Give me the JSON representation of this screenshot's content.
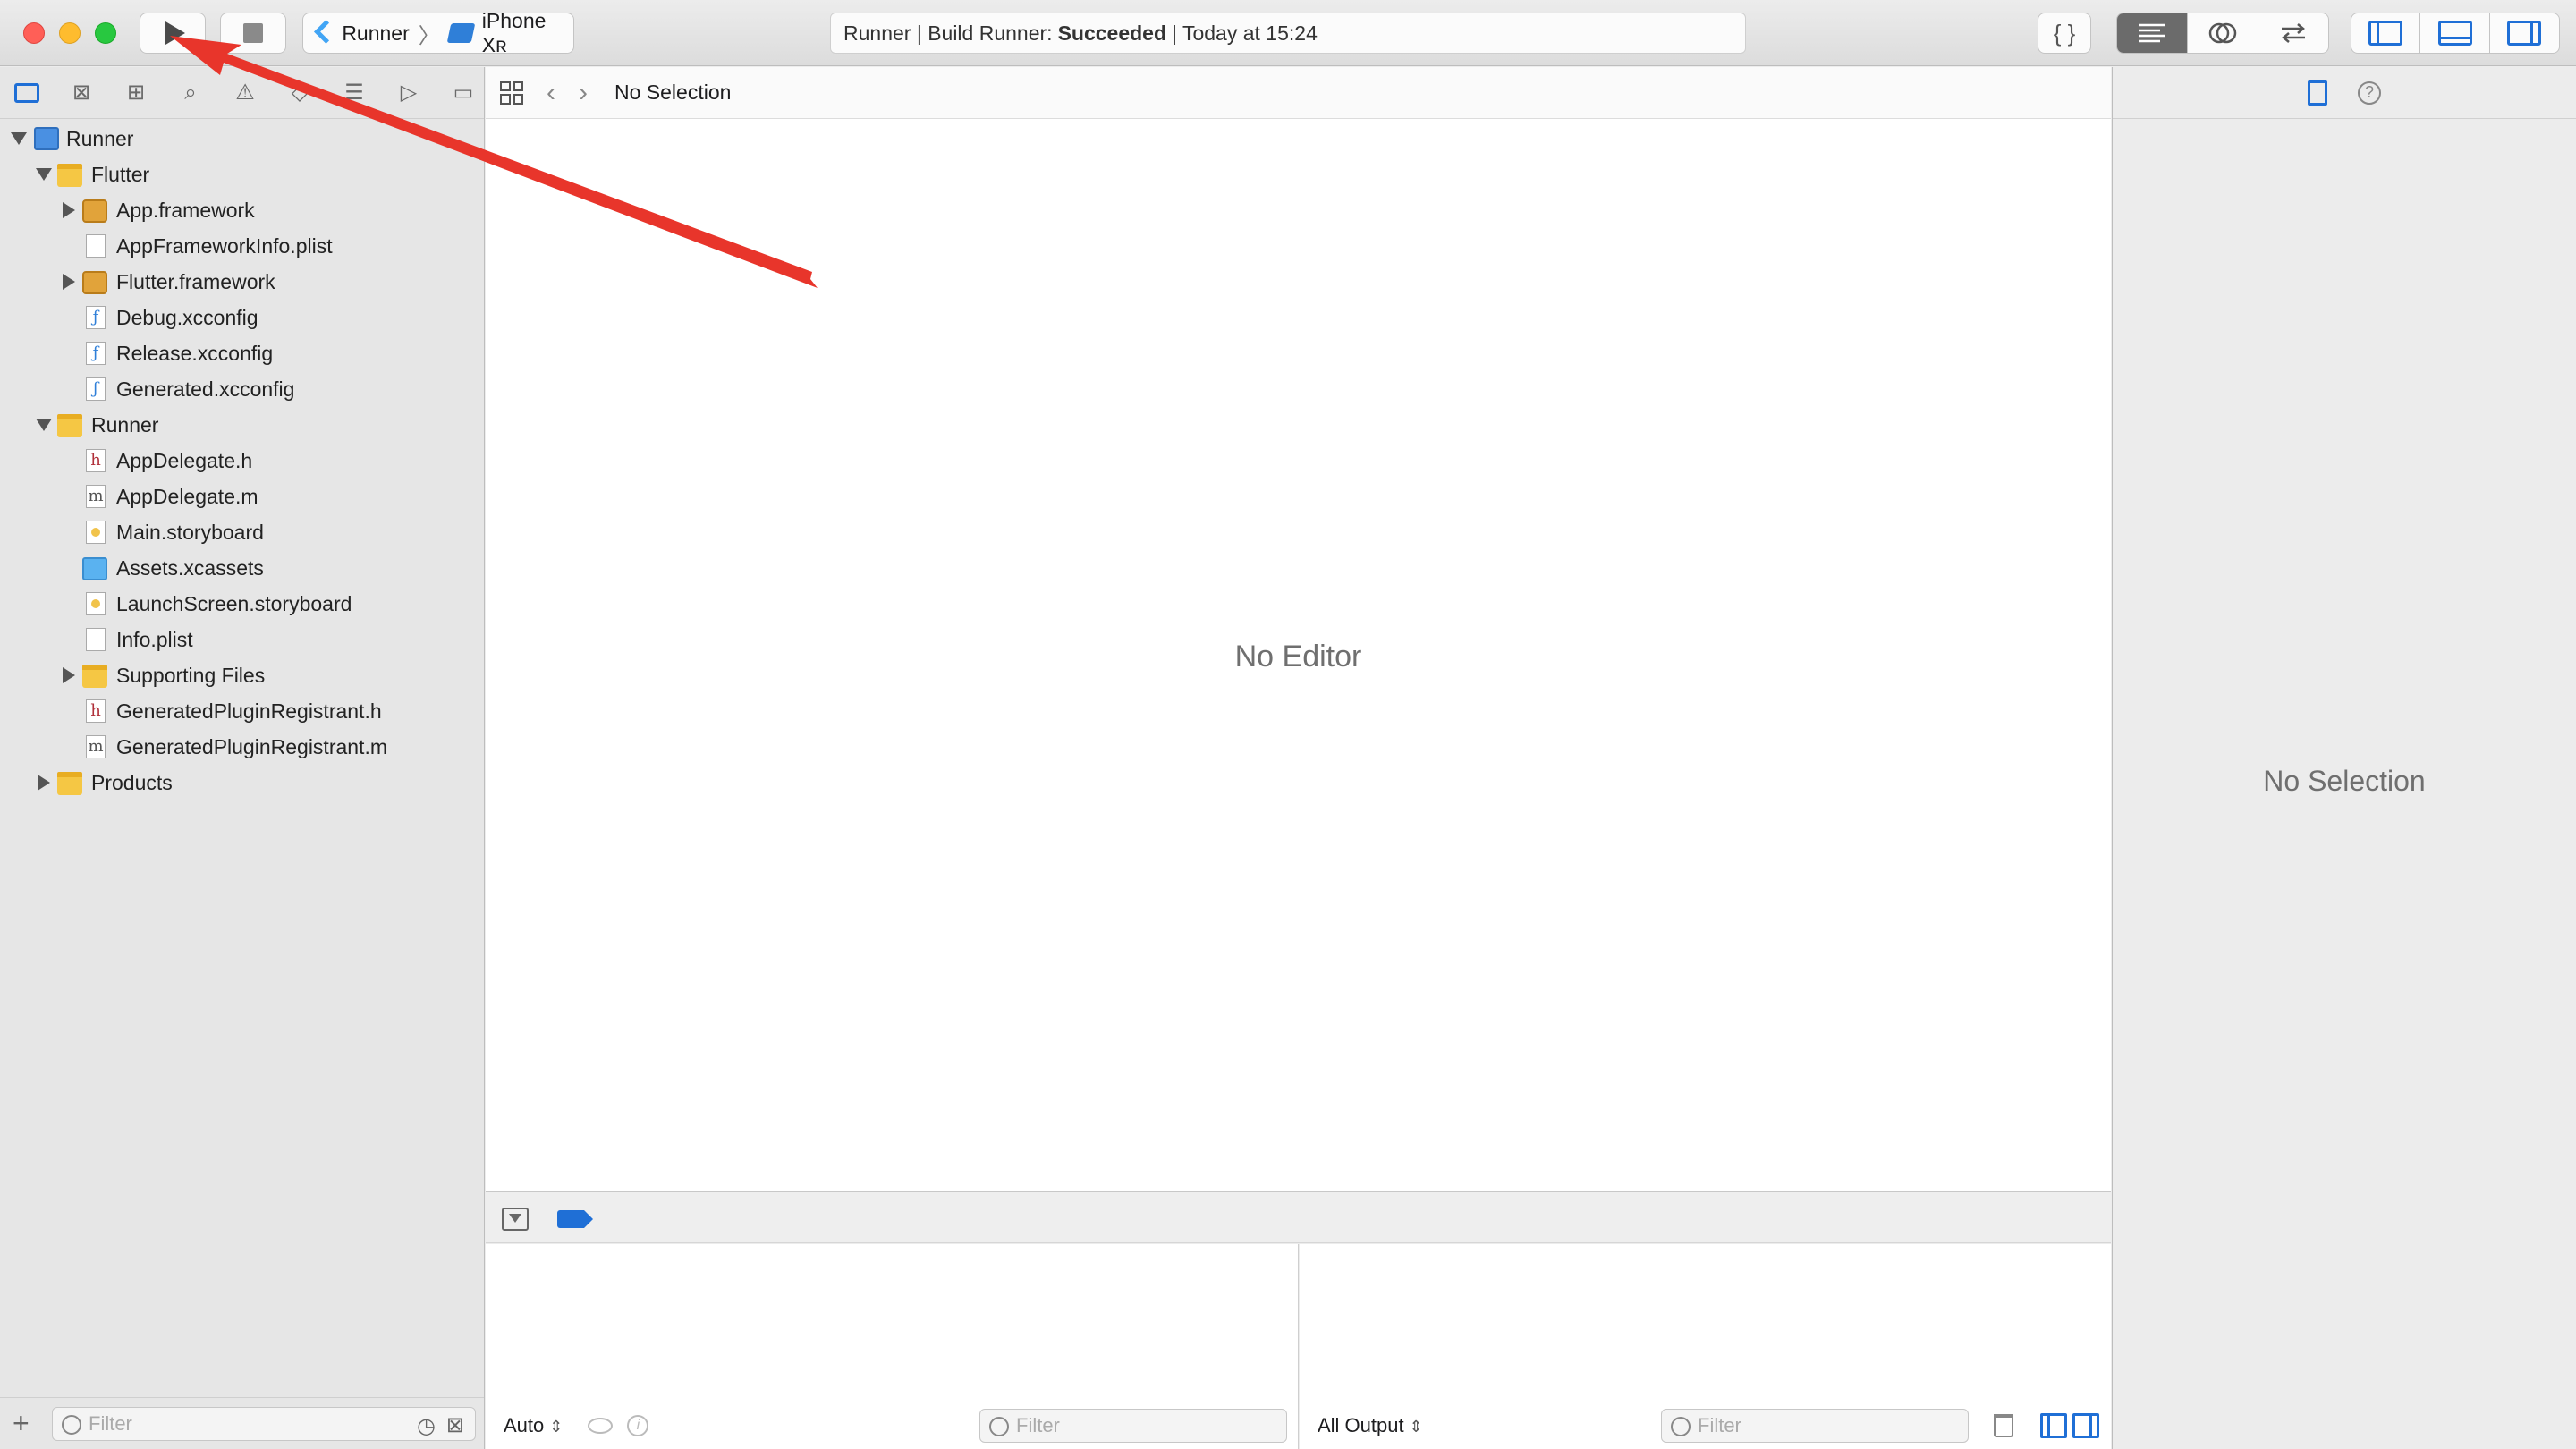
{
  "toolbar": {
    "scheme_target": "Runner",
    "scheme_device": "iPhone Xʀ",
    "activity_prefix": "Runner | Build Runner:",
    "activity_status": "Succeeded",
    "activity_time": "| Today at 15:24",
    "code_review_glyph": "{ }"
  },
  "navigator": {
    "tree": [
      {
        "label": "Runner",
        "icon": "project-icon"
      },
      {
        "label": "Flutter",
        "icon": "folder-icon"
      },
      {
        "label": "App.framework",
        "icon": "framework-icon"
      },
      {
        "label": "AppFrameworkInfo.plist",
        "icon": "plist-icon"
      },
      {
        "label": "Flutter.framework",
        "icon": "framework-icon"
      },
      {
        "label": "Debug.xcconfig",
        "icon": "xcconfig-icon"
      },
      {
        "label": "Release.xcconfig",
        "icon": "xcconfig-icon"
      },
      {
        "label": "Generated.xcconfig",
        "icon": "xcconfig-icon"
      },
      {
        "label": "Runner",
        "icon": "folder-icon"
      },
      {
        "label": "AppDelegate.h",
        "icon": "header-file-icon"
      },
      {
        "label": "AppDelegate.m",
        "icon": "source-file-icon"
      },
      {
        "label": "Main.storyboard",
        "icon": "storyboard-icon"
      },
      {
        "label": "Assets.xcassets",
        "icon": "assets-icon"
      },
      {
        "label": "LaunchScreen.storyboard",
        "icon": "storyboard-icon"
      },
      {
        "label": "Info.plist",
        "icon": "plist-icon"
      },
      {
        "label": "Supporting Files",
        "icon": "folder-icon"
      },
      {
        "label": "GeneratedPluginRegistrant.h",
        "icon": "header-file-icon"
      },
      {
        "label": "GeneratedPluginRegistrant.m",
        "icon": "source-file-icon"
      },
      {
        "label": "Products",
        "icon": "folder-icon"
      }
    ],
    "filter_placeholder": "Filter"
  },
  "editor": {
    "jump_bar_text": "No Selection",
    "empty_text": "No Editor"
  },
  "debug": {
    "variables_scope": "Auto",
    "variables_filter_placeholder": "Filter",
    "console_output": "All Output",
    "console_filter_placeholder": "Filter"
  },
  "inspector": {
    "empty_text": "No Selection"
  },
  "annotation": {
    "color": "#e8352b"
  }
}
